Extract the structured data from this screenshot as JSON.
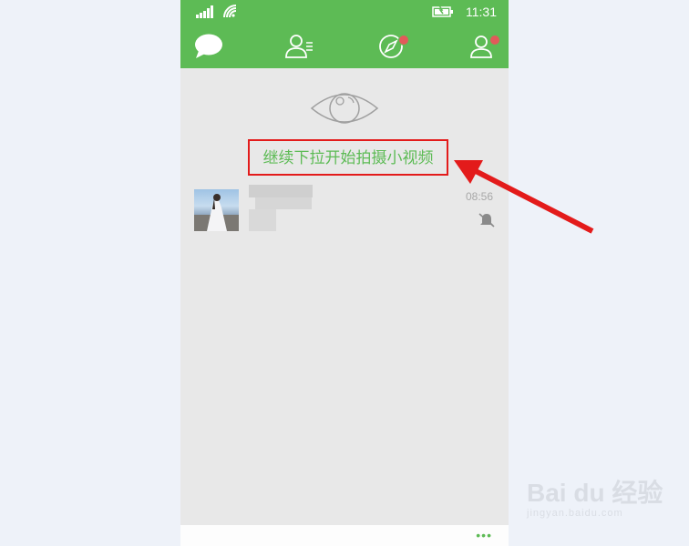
{
  "statusbar": {
    "time": "11:31"
  },
  "navbar": {
    "tabs": [
      {
        "name": "chats",
        "active": true,
        "badge": false
      },
      {
        "name": "contacts",
        "active": false,
        "badge": false
      },
      {
        "name": "discover",
        "active": false,
        "badge": true
      },
      {
        "name": "me",
        "active": false,
        "badge": true
      }
    ]
  },
  "content": {
    "pull_hint": "继续下拉开始拍摄小视频",
    "chat_item": {
      "time": "08:56",
      "muted": true
    }
  },
  "bottombar": {
    "more_label": "•••"
  },
  "watermark": {
    "main": "Bai du 经验",
    "sub": "jingyan.baidu.com"
  },
  "colors": {
    "accent": "#5dbb55",
    "annotation": "#e31b1b",
    "badge": "#e25a5a"
  }
}
